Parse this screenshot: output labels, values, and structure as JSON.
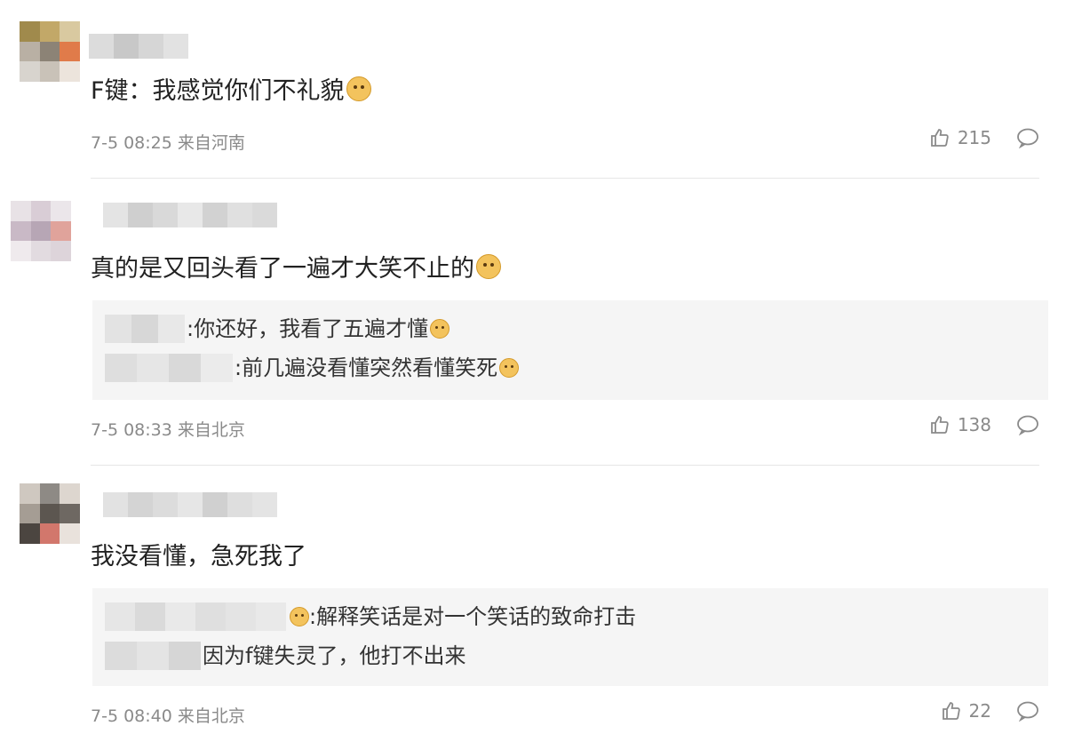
{
  "comments": [
    {
      "text": "F键：我感觉你们不礼貌",
      "meta": "7-5 08:25 来自河南",
      "likes": "215",
      "replies": []
    },
    {
      "text": "真的是又回头看了一遍才大笑不止的",
      "meta": "7-5 08:33 来自北京",
      "likes": "138",
      "replies": [
        {
          "text": ":你还好，我看了五遍才懂"
        },
        {
          "text": ":前几遍没看懂突然看懂笑死"
        }
      ]
    },
    {
      "text": "我没看懂，急死我了",
      "meta": "7-5 08:40 来自北京",
      "likes": "22",
      "replies": [
        {
          "text": ":解释笑话是对一个笑话的致命打击"
        },
        {
          "text": "因为f键失灵了，他打不出来"
        }
      ]
    }
  ],
  "icons": {
    "like": "thumbs-up-icon",
    "reply": "comment-bubble-icon",
    "emoji": "doge-emoji-icon",
    "laugh": "laughing-emoji-icon"
  },
  "colors": {
    "meta": "#8a8a8a",
    "text": "#222222",
    "reply_bg": "#f5f5f5",
    "divider": "#e6e6e6"
  }
}
